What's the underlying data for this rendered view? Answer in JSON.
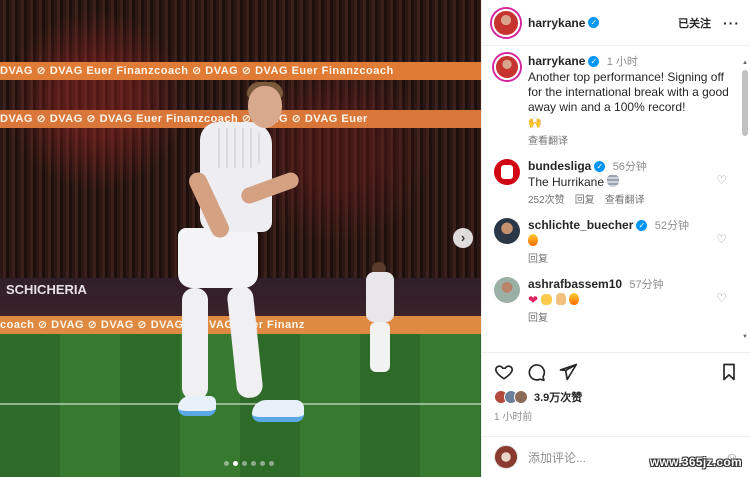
{
  "media": {
    "banner_top": "DVAG  ⊘ DVAG   Euer Finanzcoach   ⊘ DVAG   ⊘ DVAG   Euer Finanzcoach",
    "banner_mid": "DVAG  ⊘ DVAG   ⊘ DVAG   Euer Finanzcoach   ⊘ DVAG   ⊘ DVAG   Euer",
    "adboard_text": "SCHICHERIA",
    "banner_bottom": "coach   ⊘ DVAG   ⊘ DVAG   ⊘ DVAG   ⊘ DVAG   Euer Finanz",
    "next_glyph": "›",
    "carousel_dots": 6,
    "active_dot": 1
  },
  "header": {
    "username": "harrykane",
    "verified_glyph": "✓",
    "follow_label": "已关注",
    "more_glyph": "···"
  },
  "caption": {
    "username": "harrykane",
    "time": "1 小时",
    "text": "Another top performance! Signing off for the international break with a good away win and a 100% record!",
    "emoji": "🙌",
    "translate_label": "查看翻译"
  },
  "comments": [
    {
      "username": "bundesliga",
      "time": "56分钟",
      "text": "The Hurrikane",
      "likes": "252次赞",
      "reply": "回复",
      "translate": "查看翻译"
    },
    {
      "username": "schlichte_buecher",
      "time": "52分钟",
      "text": "",
      "reply": "回复"
    },
    {
      "username": "ashrafbassem10",
      "time": "57分钟",
      "text": "",
      "reply": "回复"
    }
  ],
  "actions": {
    "likes_count": "3.9万次赞",
    "post_time": "1 小时前"
  },
  "composer": {
    "placeholder": "添加评论..."
  },
  "watermark": "www.365jz.com",
  "colors": {
    "verified": "#0095f6",
    "story_ring": "#d6249f",
    "banner": "#e07b36",
    "pitch": "#2f6b28"
  }
}
